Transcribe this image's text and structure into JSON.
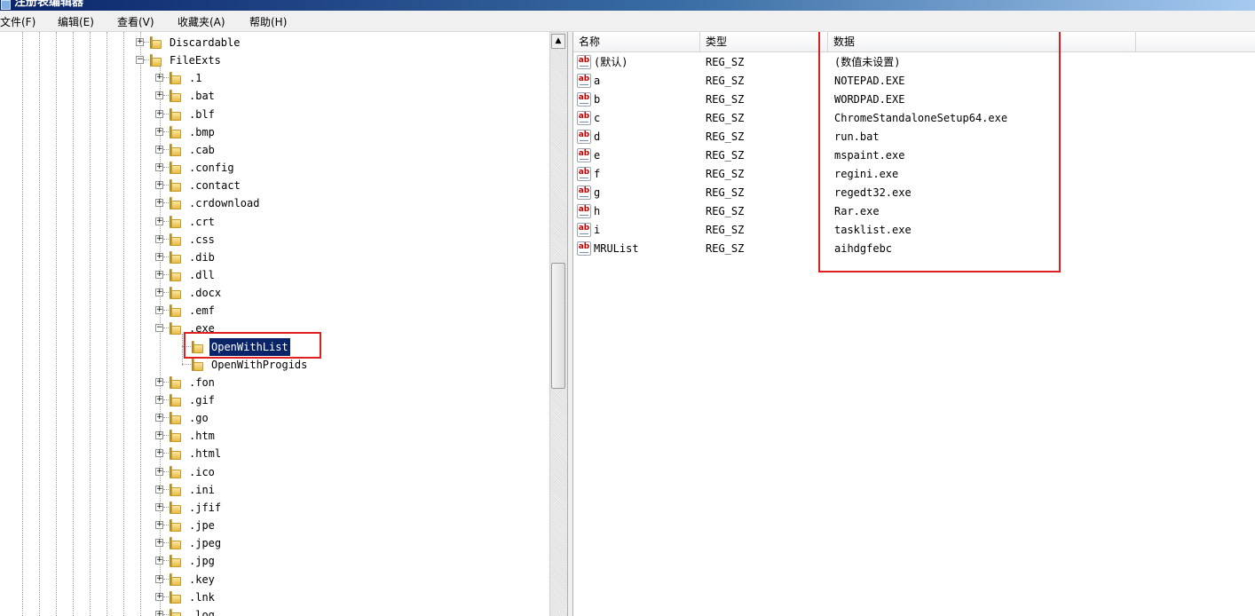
{
  "window": {
    "title": "注册表编辑器"
  },
  "menu": [
    "文件(F)",
    "编辑(E)",
    "查看(V)",
    "收藏夹(A)",
    "帮助(H)"
  ],
  "tree": {
    "items": [
      {
        "label": "Discardable",
        "expander": "+",
        "level": 1
      },
      {
        "label": "FileExts",
        "expander": "-",
        "level": 1
      },
      {
        "label": ".1",
        "expander": "+",
        "level": 2
      },
      {
        "label": ".bat",
        "expander": "+",
        "level": 2
      },
      {
        "label": ".blf",
        "expander": "+",
        "level": 2
      },
      {
        "label": ".bmp",
        "expander": "+",
        "level": 2
      },
      {
        "label": ".cab",
        "expander": "+",
        "level": 2
      },
      {
        "label": ".config",
        "expander": "+",
        "level": 2
      },
      {
        "label": ".contact",
        "expander": "+",
        "level": 2
      },
      {
        "label": ".crdownload",
        "expander": "+",
        "level": 2
      },
      {
        "label": ".crt",
        "expander": "+",
        "level": 2
      },
      {
        "label": ".css",
        "expander": "+",
        "level": 2
      },
      {
        "label": ".dib",
        "expander": "+",
        "level": 2
      },
      {
        "label": ".dll",
        "expander": "+",
        "level": 2
      },
      {
        "label": ".docx",
        "expander": "+",
        "level": 2
      },
      {
        "label": ".emf",
        "expander": "+",
        "level": 2
      },
      {
        "label": ".exe",
        "expander": "-",
        "level": 2
      },
      {
        "label": "OpenWithList",
        "expander": "",
        "level": 3,
        "selected": true
      },
      {
        "label": "OpenWithProgids",
        "expander": "",
        "level": 3
      },
      {
        "label": ".fon",
        "expander": "+",
        "level": 2
      },
      {
        "label": ".gif",
        "expander": "+",
        "level": 2
      },
      {
        "label": ".go",
        "expander": "+",
        "level": 2
      },
      {
        "label": ".htm",
        "expander": "+",
        "level": 2
      },
      {
        "label": ".html",
        "expander": "+",
        "level": 2
      },
      {
        "label": ".ico",
        "expander": "+",
        "level": 2
      },
      {
        "label": ".ini",
        "expander": "+",
        "level": 2
      },
      {
        "label": ".jfif",
        "expander": "+",
        "level": 2
      },
      {
        "label": ".jpe",
        "expander": "+",
        "level": 2
      },
      {
        "label": ".jpeg",
        "expander": "+",
        "level": 2
      },
      {
        "label": ".jpg",
        "expander": "+",
        "level": 2
      },
      {
        "label": ".key",
        "expander": "+",
        "level": 2
      },
      {
        "label": ".lnk",
        "expander": "+",
        "level": 2
      },
      {
        "label": ".log",
        "expander": "+",
        "level": 2
      }
    ]
  },
  "values": {
    "columns": [
      "名称",
      "类型",
      "数据"
    ],
    "rows": [
      {
        "name": "(默认)",
        "type": "REG_SZ",
        "data": "(数值未设置)"
      },
      {
        "name": "a",
        "type": "REG_SZ",
        "data": "NOTEPAD.EXE"
      },
      {
        "name": "b",
        "type": "REG_SZ",
        "data": "WORDPAD.EXE"
      },
      {
        "name": "c",
        "type": "REG_SZ",
        "data": "ChromeStandaloneSetup64.exe"
      },
      {
        "name": "d",
        "type": "REG_SZ",
        "data": "run.bat"
      },
      {
        "name": "e",
        "type": "REG_SZ",
        "data": "mspaint.exe"
      },
      {
        "name": "f",
        "type": "REG_SZ",
        "data": "regini.exe"
      },
      {
        "name": "g",
        "type": "REG_SZ",
        "data": "regedt32.exe"
      },
      {
        "name": "h",
        "type": "REG_SZ",
        "data": "Rar.exe"
      },
      {
        "name": "i",
        "type": "REG_SZ",
        "data": "tasklist.exe"
      },
      {
        "name": "MRUList",
        "type": "REG_SZ",
        "data": "aihdgfebc"
      }
    ],
    "icon": "string-value-icon",
    "icon_text": "ab"
  },
  "colors": {
    "selection": "#0a246a",
    "highlight_box": "#e02020"
  }
}
